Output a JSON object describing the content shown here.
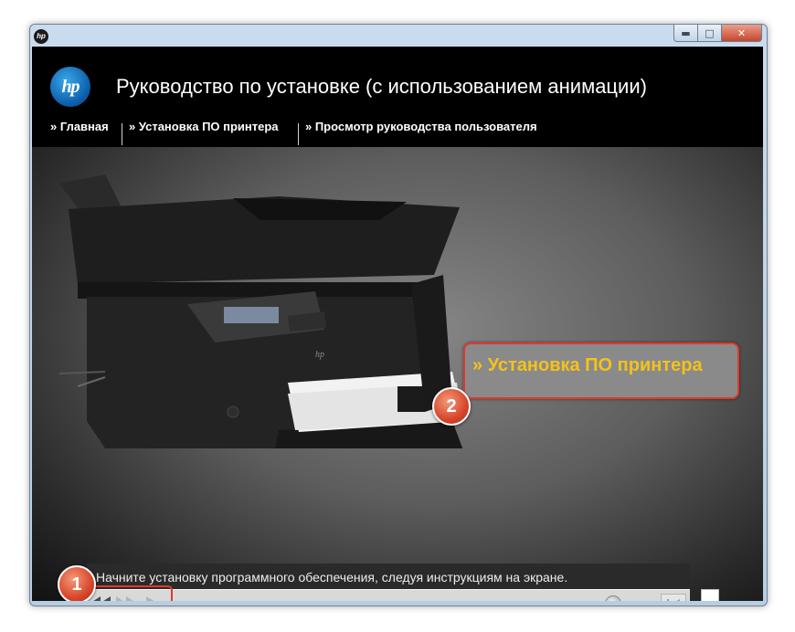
{
  "window": {
    "icon_label": "hp",
    "min_glyph": "▬",
    "max_glyph": "□",
    "close_glyph": "✕"
  },
  "header": {
    "logo_text": "hp",
    "title": "Руководство по установке (с использованием анимации)"
  },
  "nav": {
    "items": [
      {
        "label": "» Главная"
      },
      {
        "label": "» Установка ПО принтера"
      },
      {
        "label": "» Просмотр руководства пользователя"
      }
    ]
  },
  "stage": {
    "callout_label": "» Установка ПО принтера",
    "badge_1": "1",
    "badge_2": "2",
    "caption": "Начните установку программного обеспечения, следуя инструкциям на экране.",
    "progress": 0.98
  },
  "colors": {
    "accent_yellow": "#f4c21a",
    "highlight_red": "#e0392c",
    "track_pink": "#e89a9a"
  },
  "icons": [
    "hp-logo-icon",
    "rewind-icon",
    "fast-forward-icon",
    "play-icon",
    "skip-to-end-icon"
  ]
}
